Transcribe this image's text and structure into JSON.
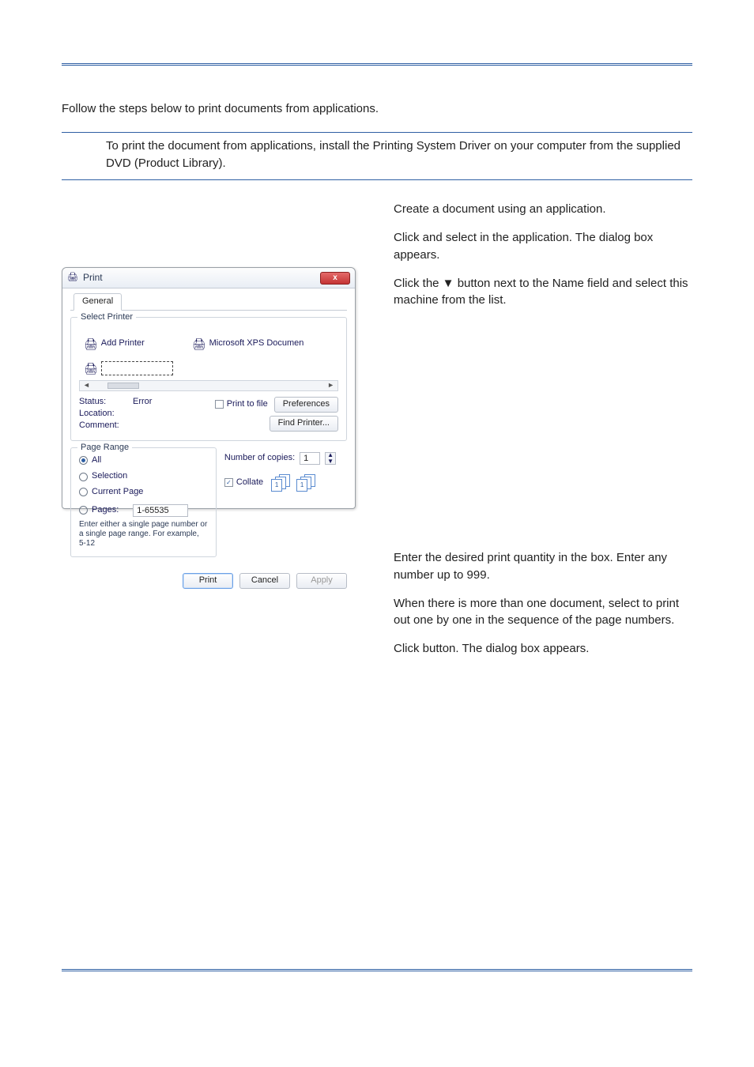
{
  "intro": "Follow the steps below to print documents from applications.",
  "note": "To print the document from applications, install the Printing System Driver on your computer from the supplied DVD (Product Library).",
  "steps": {
    "s1": "Create a document using an application.",
    "s2a": "Click ",
    "s2b": " and select ",
    "s2c": " in the application. The ",
    "s2d": " dialog box appears.",
    "s3": "Click the ▼ button next to the Name field and select this machine from the list.",
    "s4a": "Enter the desired print quantity in the ",
    "s4b": " box. Enter any number up to 999.",
    "s5a": "When there is more than one document, select ",
    "s5b": " to print out one by one in the sequence of the page numbers.",
    "s6a": "Click ",
    "s6b": " button. The ",
    "s6c": " dialog box appears."
  },
  "dlg": {
    "title": "Print",
    "close": "x",
    "tab": "General",
    "selectPrinter": "Select Printer",
    "addPrinter": "Add Printer",
    "msxps": "Microsoft XPS Documen",
    "statusLabel": "Status:",
    "statusVal": "Error",
    "locationLabel": "Location:",
    "commentLabel": "Comment:",
    "printToFile": "Print to file",
    "preferences": "Preferences",
    "findPrinter": "Find Printer...",
    "pageRange": "Page Range",
    "all": "All",
    "selection": "Selection",
    "currentPage": "Current Page",
    "pages": "Pages:",
    "pagesVal": "1-65535",
    "pageHint": "Enter either a single page number or a single page range.  For example, 5-12",
    "numCopies": "Number of copies:",
    "numVal": "1",
    "collate": "Collate",
    "btnPrint": "Print",
    "btnCancel": "Cancel",
    "btnApply": "Apply"
  }
}
